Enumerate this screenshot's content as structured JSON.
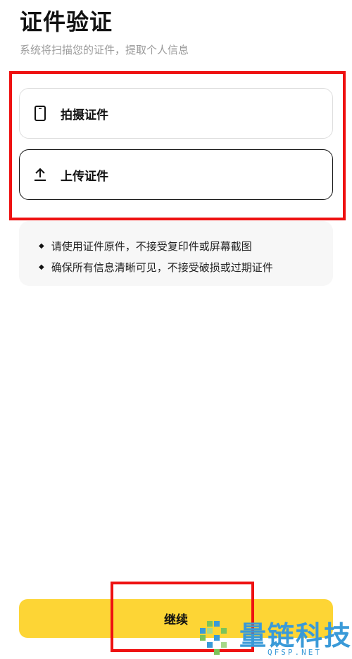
{
  "header": {
    "title": "证件验证",
    "subtitle": "系统将扫描您的证件，提取个人信息"
  },
  "options": [
    {
      "label": "拍摄证件",
      "icon": "phone-icon"
    },
    {
      "label": "上传证件",
      "icon": "upload-icon"
    }
  ],
  "tips": [
    "请使用证件原件，不接受复印件或屏幕截图",
    "确保所有信息清晰可见，不接受破损或过期证件"
  ],
  "actions": {
    "continue_label": "继续"
  },
  "watermark": {
    "text": "量链科技",
    "sub": "QFSP.NET"
  },
  "colors": {
    "accent": "#fdd535",
    "highlight": "#ee1111",
    "watermark": "#3a9ad8"
  }
}
